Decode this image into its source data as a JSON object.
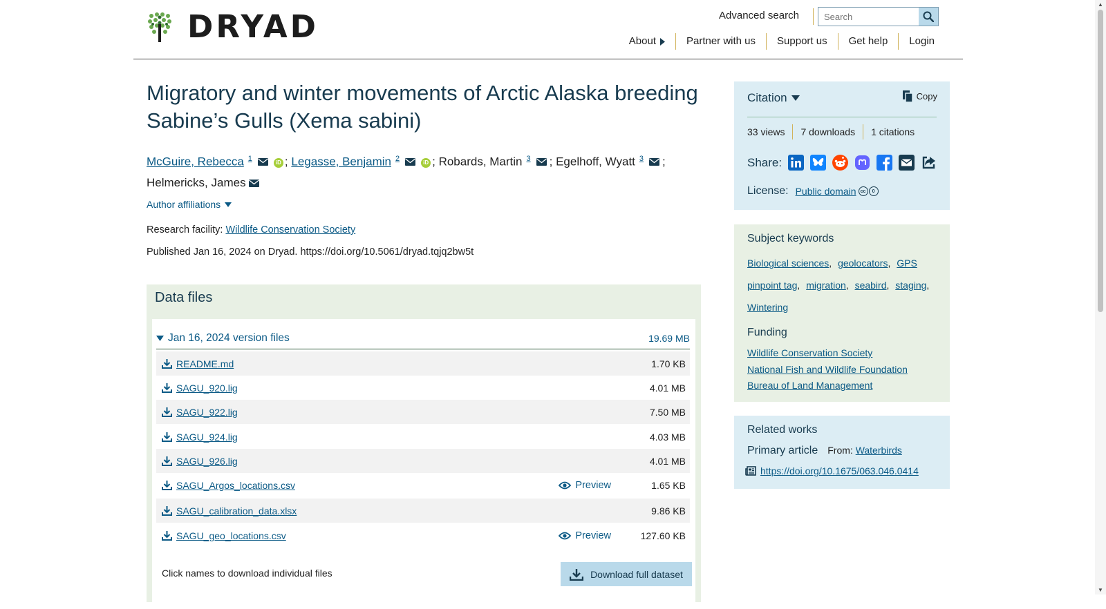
{
  "header": {
    "logo_text": "DRYAD",
    "advanced_search": "Advanced search",
    "search_placeholder": "Search",
    "nav": [
      "About",
      "Partner with us",
      "Support us",
      "Get help",
      "Login"
    ]
  },
  "dataset": {
    "title": "Migratory and winter movements of Arctic Alaska breeding Sabine’s Gulls (Xema sabini)",
    "authors": [
      {
        "name": "McGuire, Rebecca",
        "affil": "1",
        "email": true,
        "orcid": true,
        "linked": true
      },
      {
        "name": "Legasse, Benjamin",
        "affil": "2",
        "email": true,
        "orcid": true,
        "linked": true
      },
      {
        "name": "Robards, Martin",
        "affil": "3",
        "email": true,
        "orcid": false,
        "linked": false
      },
      {
        "name": "Egelhoff, Wyatt",
        "affil": "3",
        "email": true,
        "orcid": false,
        "linked": false
      },
      {
        "name": "Helmericks, James",
        "affil": "",
        "email": true,
        "orcid": false,
        "linked": false
      }
    ],
    "separator": ";",
    "author_affiliations": "Author affiliations",
    "research_facility_label": "Research facility:",
    "research_facility": "Wildlife Conservation Society",
    "published": "Published Jan 16, 2024 on Dryad. https://doi.org/10.5061/dryad.tqjq2bw5t"
  },
  "data_files": {
    "heading": "Data files",
    "version_label": "Jan 16, 2024 version files",
    "version_size": "19.69 MB",
    "files": [
      {
        "name": "README.md",
        "size": "1.70 KB",
        "preview": false
      },
      {
        "name": "SAGU_920.lig",
        "size": "4.01 MB",
        "preview": false
      },
      {
        "name": "SAGU_922.lig",
        "size": "7.50 MB",
        "preview": false
      },
      {
        "name": "SAGU_924.lig",
        "size": "4.03 MB",
        "preview": false
      },
      {
        "name": "SAGU_926.lig",
        "size": "4.01 MB",
        "preview": false
      },
      {
        "name": "SAGU_Argos_locations.csv",
        "size": "1.65 KB",
        "preview": true
      },
      {
        "name": "SAGU_calibration_data.xlsx",
        "size": "9.86 KB",
        "preview": false
      },
      {
        "name": "SAGU_geo_locations.csv",
        "size": "127.60 KB",
        "preview": true
      }
    ],
    "preview_label": "Preview",
    "click_note": "Click names to download individual files",
    "download_full": "Download full dataset"
  },
  "citation": {
    "title": "Citation",
    "copy": "Copy",
    "views": "33 views",
    "downloads": "7 downloads",
    "citations": "1 citations",
    "share_label": "Share:",
    "share_icons": [
      "linkedin-icon",
      "bluesky-icon",
      "reddit-icon",
      "mastodon-icon",
      "facebook-icon",
      "email-icon",
      "share-icon"
    ],
    "license_label": "License:",
    "license_value": "Public domain"
  },
  "keywords": {
    "heading": "Subject keywords",
    "items": [
      "Biological sciences",
      "geolocators",
      "GPS",
      "pinpoint tag",
      "migration",
      "seabird",
      "staging",
      "Wintering"
    ],
    "funding_heading": "Funding",
    "funders": [
      "Wildlife Conservation Society",
      "National Fish and Wildlife Foundation",
      "Bureau of Land Management"
    ]
  },
  "related": {
    "heading": "Related works",
    "primary_label": "Primary article",
    "from_label": "From:",
    "from_value": "Waterbirds",
    "doi": "https://doi.org/10.1675/063.046.0414"
  },
  "colors": {
    "brand_green": "#6aa84f",
    "link": "#0b5a86",
    "heading": "#183b4f",
    "citation_bg": "#dcedf4",
    "keywords_bg": "#e8f0e4",
    "accent_divider": "#d1b35c"
  }
}
